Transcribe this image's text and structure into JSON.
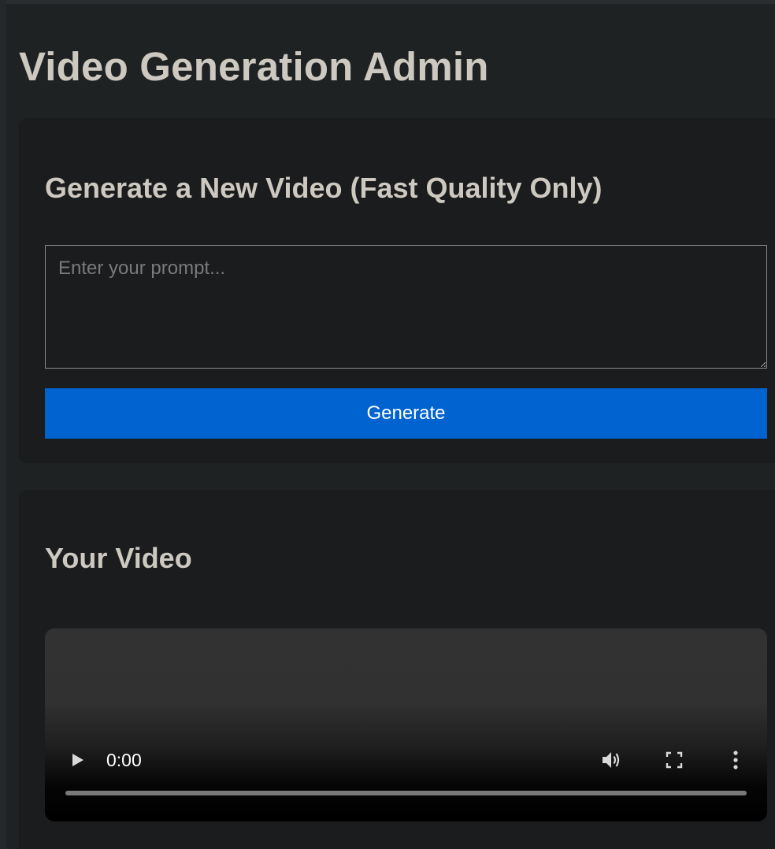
{
  "page": {
    "title": "Video Generation Admin"
  },
  "generate_section": {
    "title": "Generate a New Video (Fast Quality Only)",
    "prompt_placeholder": "Enter your prompt...",
    "prompt_value": "",
    "generate_label": "Generate"
  },
  "video_section": {
    "title": "Your Video",
    "player": {
      "time": "0:00",
      "progress": 0,
      "controls": [
        "play-icon",
        "volume-icon",
        "fullscreen-icon",
        "more-options-icon"
      ]
    }
  },
  "colors": {
    "background": "#1f2223",
    "card": "#1b1c1e",
    "heading_text": "#cdc8c0",
    "button": "#0063cf",
    "button_text": "#ffffff"
  }
}
